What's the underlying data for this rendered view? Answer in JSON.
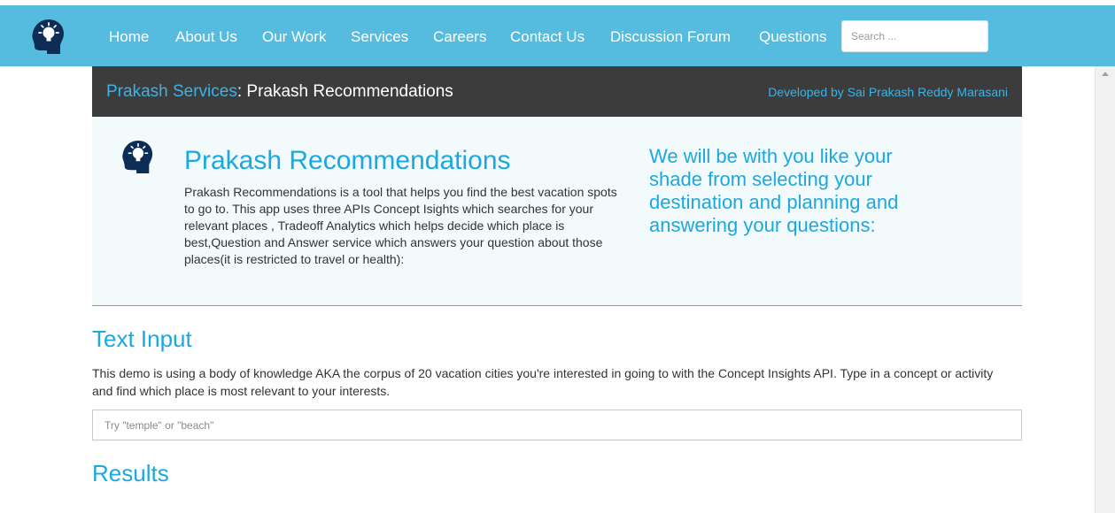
{
  "nav": {
    "items": [
      {
        "id": "home",
        "label": "Home"
      },
      {
        "id": "about-us",
        "label": "About Us"
      },
      {
        "id": "our-work",
        "label": "Our Work"
      },
      {
        "id": "services",
        "label": "Services"
      },
      {
        "id": "careers",
        "label": "Careers"
      },
      {
        "id": "contact-us",
        "label": "Contact Us"
      },
      {
        "id": "discussion-forum",
        "label": "Discussion Forum"
      },
      {
        "id": "questions",
        "label": "Questions"
      }
    ],
    "search_placeholder": "Search ..."
  },
  "title_bar": {
    "crumb_link": "Prakash Services",
    "crumb_separator": ":",
    "crumb_current": "Prakash Recommendations",
    "credit": "Developed by Sai Prakash Reddy Marasani"
  },
  "hero": {
    "title": "Prakash Recommendations",
    "description": "Prakash Recommendations is a tool that helps you find the best vacation spots to go to. This app uses three APIs Concept Isights which searches for your relevant places , Tradeoff Analytics which helps decide which place is best,Question and Answer service which answers your question about those places(it is restricted to travel or health):",
    "tagline": "We will be with you like your shade from selecting your destination and planning and answering your questions:"
  },
  "text_input": {
    "heading": "Text Input",
    "description": "This demo is using a body of knowledge AKA the corpus of 20 vacation cities you're interested in going to with the Concept Insights API. Type in a concept or activity and find which place is most relevant to your interests.",
    "placeholder": "Try \"temple\" or \"beach\""
  },
  "results": {
    "heading": "Results"
  },
  "icons": {
    "logo": "head-lightbulb-icon",
    "hero": "head-lightbulb-icon",
    "scroll_up": "scroll-up-arrow-icon"
  },
  "colors": {
    "navbar": "#56bcdf",
    "accent": "#1ba8e0",
    "title_bar": "#3c3c3c",
    "hero_bg": "#f2fafc"
  }
}
